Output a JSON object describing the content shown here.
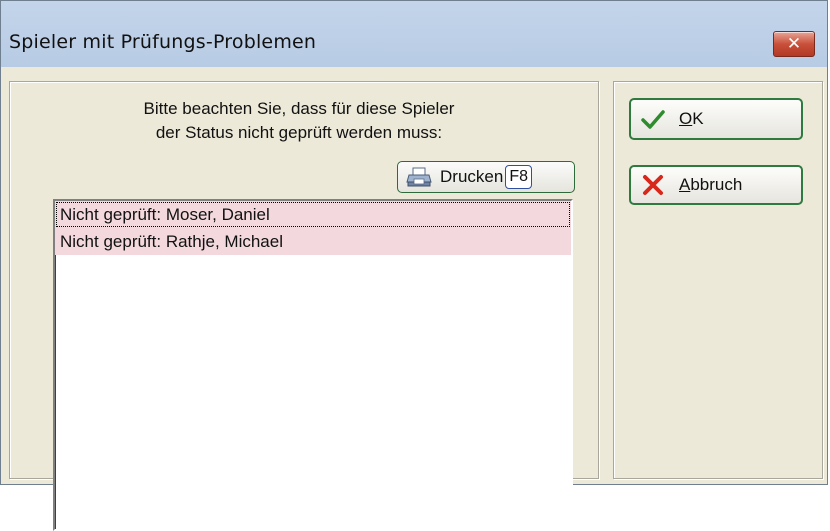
{
  "window": {
    "title": "Spieler mit Prüfungs-Problemen",
    "close_label": "✕"
  },
  "message": {
    "line1": "Bitte beachten Sie, dass für diese Spieler",
    "line2": "der Status nicht geprüft werden muss:"
  },
  "print_button": {
    "label": "Drucken",
    "shortcut": "F8",
    "icon": "printer-icon"
  },
  "list": {
    "items": [
      "Nicht geprüft: Moser, Daniel",
      "Nicht geprüft: Rathje, Michael"
    ]
  },
  "buttons": {
    "ok": {
      "mnemonic": "O",
      "rest": "K",
      "icon": "checkmark-icon"
    },
    "cancel": {
      "mnemonic": "A",
      "rest": "bbruch",
      "icon": "cross-icon"
    }
  },
  "colors": {
    "titlebar": "#b7cbe4",
    "dialog_bg": "#ece9d8",
    "list_highlight": "#f3d9de",
    "close_button": "#c9503a",
    "button_border": "#2f7a3e"
  }
}
